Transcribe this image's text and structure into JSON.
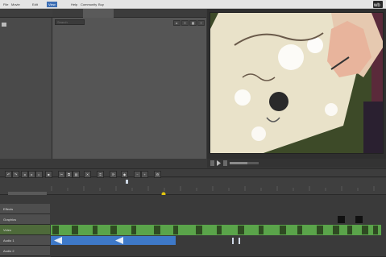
{
  "menu": {
    "items": [
      "File",
      "Movie",
      "Edit",
      "View",
      "Help",
      "Community",
      "Buy"
    ],
    "active_index": 3,
    "window_title": ""
  },
  "library": {
    "header": "",
    "item": ""
  },
  "tabs": [
    "",
    "",
    "",
    "",
    ""
  ],
  "panel": {
    "search_placeholder": "Search"
  },
  "tracks": [
    {
      "label": "Effects"
    },
    {
      "label": "Graphics"
    },
    {
      "label": "Video"
    },
    {
      "label": "Audio 1"
    },
    {
      "label": "Audio 2"
    }
  ],
  "colors": {
    "accent": "#3d6fb5",
    "video_clip": "#5aa44a",
    "audio_clip": "#3e79c8",
    "playhead": "#e3c60e",
    "preview_border": "#222222"
  }
}
